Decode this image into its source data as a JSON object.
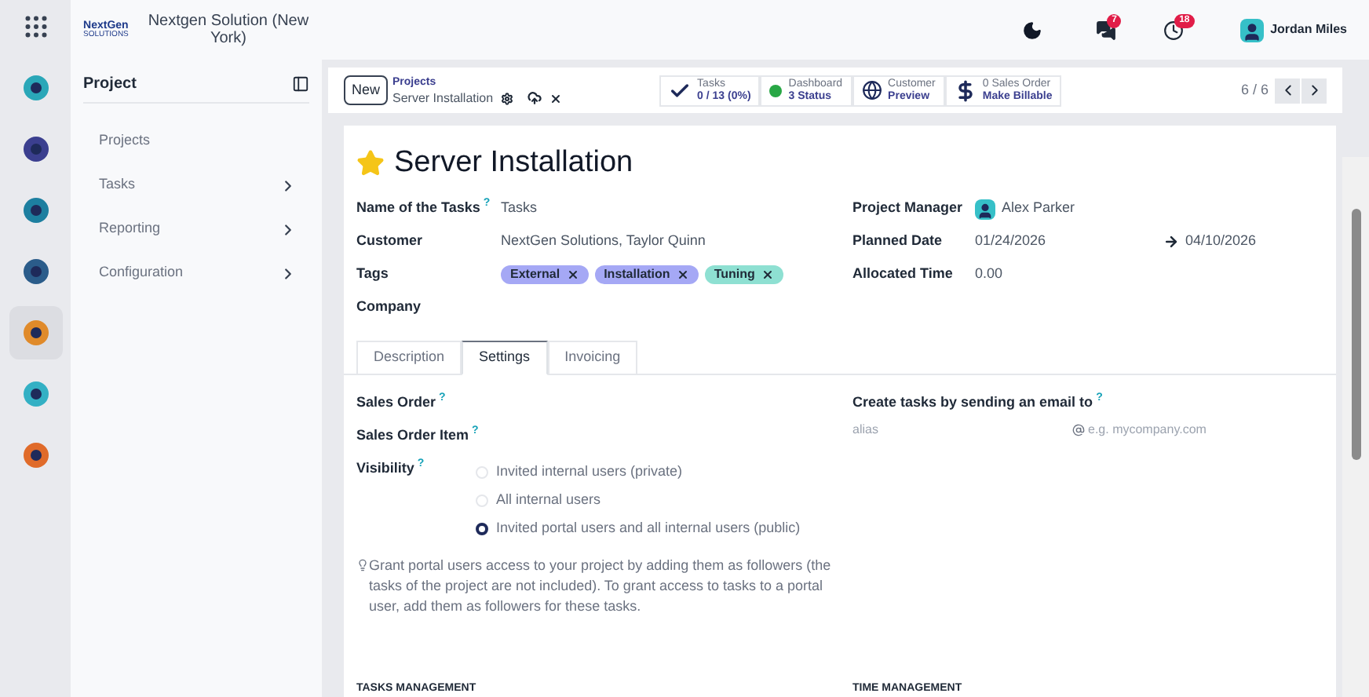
{
  "app_rail": [
    {
      "kind": "apps",
      "selected": false
    },
    {
      "kind": "app",
      "selected": false,
      "color": "#2aa7b8"
    },
    {
      "kind": "app",
      "selected": false,
      "color": "#3b3f8f"
    },
    {
      "kind": "app",
      "selected": false,
      "color": "#1d7fa0"
    },
    {
      "kind": "app",
      "selected": false,
      "color": "#2b5c8a"
    },
    {
      "kind": "app",
      "selected": true,
      "color": "#e08a2a"
    },
    {
      "kind": "app",
      "selected": false,
      "color": "#33b0c4"
    },
    {
      "kind": "app",
      "selected": false,
      "color": "#e06b2a"
    }
  ],
  "company": {
    "logo_text": "NextGen",
    "logo_subtext": "SOLUTIONS",
    "name": "Nextgen Solution (New York)"
  },
  "sidebar": {
    "title": "Project",
    "items": [
      {
        "label": "Projects",
        "expandable": false
      },
      {
        "label": "Tasks",
        "expandable": true
      },
      {
        "label": "Reporting",
        "expandable": true
      },
      {
        "label": "Configuration",
        "expandable": true
      }
    ]
  },
  "topbar": {
    "messages_count": "7",
    "activities_count": "18",
    "user": "Jordan Miles"
  },
  "control_panel": {
    "new_button": "New",
    "breadcrumb": "Projects",
    "record": "Server Installation",
    "pager": "6 / 6",
    "stat_buttons": [
      {
        "kind": "check",
        "line1": "Tasks",
        "line2": "0 / 13 (0%)"
      },
      {
        "kind": "status",
        "line1": "Dashboard",
        "line2": "3 Status",
        "color": "#28a745"
      },
      {
        "kind": "globe",
        "line1": "Customer",
        "line2": "Preview"
      },
      {
        "kind": "dollar",
        "line1": "0 Sales Order",
        "line2": "Make Billable"
      }
    ]
  },
  "form": {
    "starred": true,
    "title": "Server Installation",
    "left_fields": [
      {
        "label": "Name of the Tasks",
        "help": "?",
        "kind": "text",
        "value": "Tasks"
      },
      {
        "label": "Customer",
        "kind": "text",
        "value": "NextGen Solutions, Taylor Quinn"
      },
      {
        "label": "Tags",
        "kind": "tags",
        "tags": [
          {
            "label": "External",
            "color": "#a5a8f5"
          },
          {
            "label": "Installation",
            "color": "#a5a8f5"
          },
          {
            "label": "Tuning",
            "color": "#8ee0d2"
          }
        ]
      },
      {
        "label": "Company",
        "kind": "text"
      }
    ],
    "right_fields": [
      {
        "label": "Project Manager",
        "kind": "user",
        "value": "Alex Parker"
      },
      {
        "label": "Planned Date",
        "kind": "daterange",
        "value": "01/24/2026",
        "end": "04/10/2026"
      },
      {
        "label": "Allocated Time",
        "kind": "text",
        "value": "0.00"
      }
    ],
    "tabs": [
      {
        "label": "Description",
        "selected": false
      },
      {
        "label": "Settings",
        "selected": true
      },
      {
        "label": "Invoicing",
        "selected": false
      }
    ],
    "settings": {
      "sales_order": {
        "label": "Sales Order",
        "help": "?"
      },
      "sales_order_item": {
        "label": "Sales Order Item",
        "help": "?"
      },
      "visibility": {
        "label": "Visibility",
        "help": "?",
        "options": [
          {
            "label": "Invited internal users (private)",
            "selected": false
          },
          {
            "label": "All internal users",
            "selected": false
          },
          {
            "label": "Invited portal users and all internal users (public)",
            "selected": true
          }
        ]
      },
      "hint": "Grant portal users access to your project by adding them as followers (the tasks of the project are not included). To grant access to tasks to a portal user, add them as followers for these tasks.",
      "email": {
        "label": "Create tasks by sending an email to",
        "help": "?",
        "alias_placeholder": "alias",
        "domain_placeholder": "e.g. mycompany.com"
      }
    },
    "sections": [
      {
        "title": "TASKS MANAGEMENT"
      },
      {
        "title": "TIME MANAGEMENT"
      }
    ]
  }
}
